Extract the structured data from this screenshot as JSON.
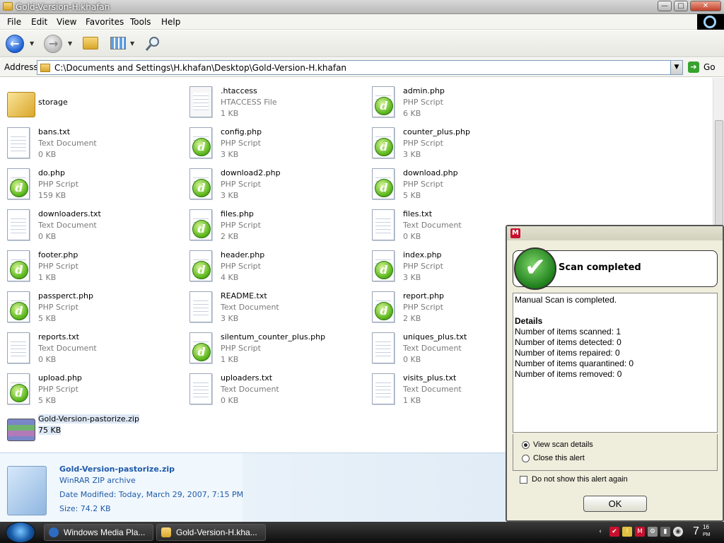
{
  "window": {
    "title": "Gold-Version-H.khafan",
    "min_label": "—",
    "max_label": "□",
    "close_label": "✕"
  },
  "menu": [
    "File",
    "Edit",
    "View",
    "Favorites",
    "Tools",
    "Help"
  ],
  "address": {
    "label": "Address",
    "path": "C:\\Documents and Settings\\H.khafan\\Desktop\\Gold-Version-H.khafan",
    "go_label": "Go"
  },
  "files": [
    {
      "name": "storage",
      "type": "",
      "size": "",
      "icon": "folder-icon"
    },
    {
      "name": ".htaccess",
      "type": "HTACCESS File",
      "size": "1 KB",
      "icon": "file-icon"
    },
    {
      "name": "admin.php",
      "type": "PHP Script",
      "size": "6 KB",
      "icon": "php-icon"
    },
    {
      "name": "bans.txt",
      "type": "Text Document",
      "size": "0 KB",
      "icon": "text-icon"
    },
    {
      "name": "config.php",
      "type": "PHP Script",
      "size": "3 KB",
      "icon": "php-icon"
    },
    {
      "name": "counter_plus.php",
      "type": "PHP Script",
      "size": "3 KB",
      "icon": "php-icon"
    },
    {
      "name": "do.php",
      "type": "PHP Script",
      "size": "159 KB",
      "icon": "php-icon"
    },
    {
      "name": "download2.php",
      "type": "PHP Script",
      "size": "3 KB",
      "icon": "php-icon"
    },
    {
      "name": "download.php",
      "type": "PHP Script",
      "size": "5 KB",
      "icon": "php-icon"
    },
    {
      "name": "downloaders.txt",
      "type": "Text Document",
      "size": "0 KB",
      "icon": "text-icon"
    },
    {
      "name": "files.php",
      "type": "PHP Script",
      "size": "2 KB",
      "icon": "php-icon"
    },
    {
      "name": "files.txt",
      "type": "Text Document",
      "size": "0 KB",
      "icon": "text-icon"
    },
    {
      "name": "footer.php",
      "type": "PHP Script",
      "size": "1 KB",
      "icon": "php-icon"
    },
    {
      "name": "header.php",
      "type": "PHP Script",
      "size": "4 KB",
      "icon": "php-icon"
    },
    {
      "name": "index.php",
      "type": "PHP Script",
      "size": "3 KB",
      "icon": "php-icon"
    },
    {
      "name": "passperct.php",
      "type": "PHP Script",
      "size": "5 KB",
      "icon": "php-icon"
    },
    {
      "name": "README.txt",
      "type": "Text Document",
      "size": "3 KB",
      "icon": "text-icon"
    },
    {
      "name": "report.php",
      "type": "PHP Script",
      "size": "2 KB",
      "icon": "php-icon"
    },
    {
      "name": "reports.txt",
      "type": "Text Document",
      "size": "0 KB",
      "icon": "text-icon"
    },
    {
      "name": "silentum_counter_plus.php",
      "type": "PHP Script",
      "size": "1 KB",
      "icon": "php-icon"
    },
    {
      "name": "uniques_plus.txt",
      "type": "Text Document",
      "size": "0 KB",
      "icon": "text-icon"
    },
    {
      "name": "upload.php",
      "type": "PHP Script",
      "size": "5 KB",
      "icon": "php-icon"
    },
    {
      "name": "uploaders.txt",
      "type": "Text Document",
      "size": "0 KB",
      "icon": "text-icon"
    },
    {
      "name": "visits_plus.txt",
      "type": "Text Document",
      "size": "1 KB",
      "icon": "text-icon"
    },
    {
      "name": "Gold-Version-pastorize.zip",
      "type": "75 KB",
      "size": "",
      "icon": "zip-icon"
    }
  ],
  "details": {
    "name": "Gold-Version-pastorize.zip",
    "type": "WinRAR ZIP archive",
    "modified": "Date Modified: Today, March 29, 2007, 7:15 PM",
    "size": "Size: 74.2 KB"
  },
  "scan_dialog": {
    "logo": "M",
    "header": "Scan completed",
    "lines": [
      "Manual Scan is completed.",
      "",
      "Details",
      "Number of items scanned: 1",
      "Number of items detected: 0",
      "Number of items repaired: 0",
      "Number of items quarantined: 0",
      "Number of items removed: 0"
    ],
    "option_view": "View scan details",
    "option_close": "Close this alert",
    "no_show": "Do not show this alert again",
    "ok": "OK"
  },
  "taskbar": {
    "tasks": [
      {
        "label": "Windows Media Pla...",
        "icon": "media-player-icon"
      },
      {
        "label": "Gold-Version-H.kha...",
        "icon": "folder-icon"
      }
    ],
    "clock": "7",
    "clock_min": "16",
    "clock_ampm": "PM"
  }
}
